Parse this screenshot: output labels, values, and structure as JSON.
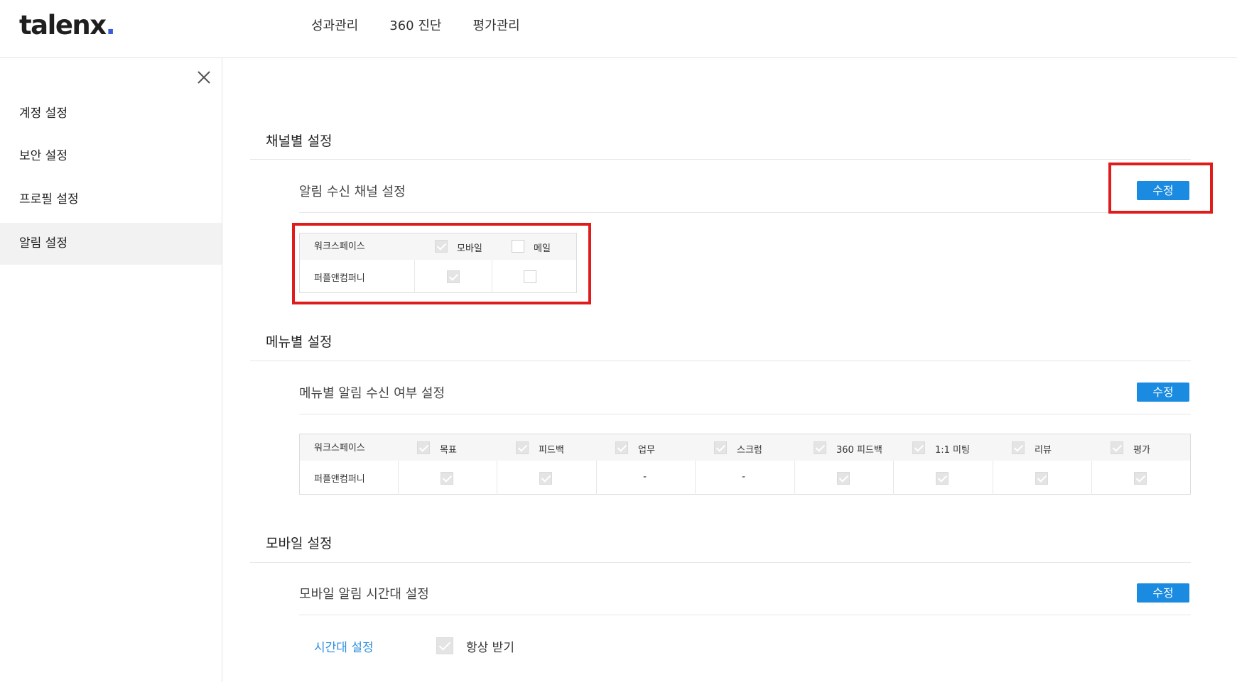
{
  "app": {
    "logo_text": "talenx",
    "logo_dot": "."
  },
  "nav": {
    "items": [
      "성과관리",
      "360 진단",
      "평가관리"
    ]
  },
  "sidebar": {
    "close_icon": "close-icon",
    "items": [
      {
        "label": "계정 설정",
        "active": false
      },
      {
        "label": "보안 설정",
        "active": false
      },
      {
        "label": "프로필 설정",
        "active": false
      },
      {
        "label": "알림 설정",
        "active": true
      }
    ]
  },
  "channel_section": {
    "title": "채널별 설정",
    "row_label": "알림 수신 채널 설정",
    "edit_label": "수정",
    "table": {
      "header": {
        "workspace": "워크스페이스",
        "mobile": "모바일",
        "mail": "메일",
        "mobile_checked": true,
        "mail_checked": false
      },
      "rows": [
        {
          "workspace": "퍼플앤컴퍼니",
          "mobile_checked": true,
          "mail_checked": false
        }
      ]
    }
  },
  "menu_section": {
    "title": "메뉴별 설정",
    "row_label": "메뉴별 알림 수신 여부 설정",
    "edit_label": "수정",
    "table": {
      "header": {
        "workspace": "워크스페이스",
        "columns": [
          "목표",
          "피드백",
          "업무",
          "스크럼",
          "360 피드백",
          "1:1 미팅",
          "리뷰",
          "평가"
        ],
        "checked": [
          true,
          true,
          true,
          true,
          true,
          true,
          true,
          true
        ]
      },
      "rows": [
        {
          "workspace": "퍼플앤컴퍼니",
          "values": [
            "check",
            "check",
            "-",
            "-",
            "check",
            "check",
            "check",
            "check"
          ]
        }
      ]
    }
  },
  "mobile_section": {
    "title": "모바일 설정",
    "row_label": "모바일 알림 시간대 설정",
    "edit_label": "수정",
    "time_link": "시간대 설정",
    "always_label": "항상 받기",
    "always_checked": true
  },
  "colors": {
    "accent": "#1a8be0",
    "highlight": "#e01b1b",
    "link": "#2f8fdf"
  }
}
